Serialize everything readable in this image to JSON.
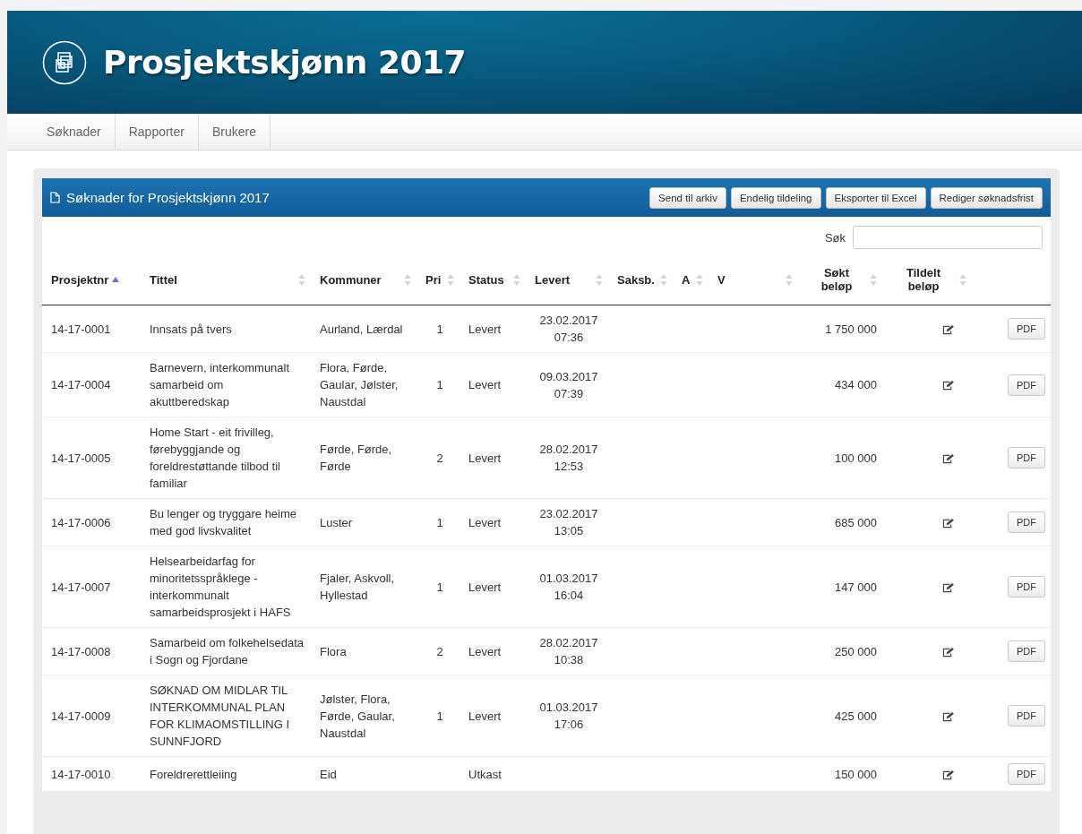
{
  "header": {
    "title": "Prosjektskjønn 2017"
  },
  "nav": [
    {
      "label": "Søknader"
    },
    {
      "label": "Rapporter"
    },
    {
      "label": "Brukere"
    }
  ],
  "panel": {
    "title": "Søknader for Prosjektskjønn 2017",
    "buttons": [
      "Send til arkiv",
      "Endelig tildeling",
      "Eksporter til Excel",
      "Rediger søknadsfrist"
    ]
  },
  "search": {
    "label": "Søk"
  },
  "table": {
    "columns": [
      {
        "label": "Prosjektnr",
        "sorted": true,
        "kind": "text"
      },
      {
        "label": "Tittel",
        "sorted": false,
        "kind": "text"
      },
      {
        "label": "Kommuner",
        "sorted": false,
        "kind": "text"
      },
      {
        "label": "Pri",
        "sorted": false,
        "kind": "text"
      },
      {
        "label": "Status",
        "sorted": false,
        "kind": "text"
      },
      {
        "label": "Levert",
        "sorted": false,
        "kind": "text"
      },
      {
        "label": "Saksb.",
        "sorted": false,
        "kind": "text"
      },
      {
        "label": "A",
        "sorted": false,
        "kind": "text"
      },
      {
        "label": "V",
        "sorted": false,
        "kind": "text"
      },
      {
        "label": "Søkt beløp",
        "sorted": false,
        "kind": "amount"
      },
      {
        "label": "Tildelt beløp",
        "sorted": false,
        "kind": "amount"
      }
    ],
    "rows": [
      {
        "id": "14-17-0001",
        "title": "Innsats på tvers",
        "municipalities": "Aurland, Lærdal",
        "pri": "1",
        "status": "Levert",
        "date": "23.02.2017",
        "time": "07:36",
        "amount": "1 750 000",
        "pdf": "PDF"
      },
      {
        "id": "14-17-0004",
        "title": "Barnevern, interkommunalt samarbeid om akuttberedskap",
        "municipalities": "Flora, Førde, Gaular, Jølster, Naustdal",
        "pri": "1",
        "status": "Levert",
        "date": "09.03.2017",
        "time": "07:39",
        "amount": "434 000",
        "pdf": "PDF"
      },
      {
        "id": "14-17-0005",
        "title": "Home Start - eit frivilleg, førebyggjande og foreldrestøttande tilbod til familiar",
        "municipalities": "Førde, Førde, Førde",
        "pri": "2",
        "status": "Levert",
        "date": "28.02.2017",
        "time": "12:53",
        "amount": "100 000",
        "pdf": "PDF"
      },
      {
        "id": "14-17-0006",
        "title": "Bu lenger og tryggare heime med god livskvalitet",
        "municipalities": "Luster",
        "pri": "1",
        "status": "Levert",
        "date": "23.02.2017",
        "time": "13:05",
        "amount": "685 000",
        "pdf": "PDF"
      },
      {
        "id": "14-17-0007",
        "title": "Helsearbeidarfag for minoritetsspråklege - interkommunalt samarbeidsprosjekt i HAFS",
        "municipalities": "Fjaler, Askvoll, Hyllestad",
        "pri": "1",
        "status": "Levert",
        "date": "01.03.2017",
        "time": "16:04",
        "amount": "147 000",
        "pdf": "PDF"
      },
      {
        "id": "14-17-0008",
        "title": "Samarbeid om folkehelsedata i Sogn og Fjordane",
        "municipalities": "Flora",
        "pri": "2",
        "status": "Levert",
        "date": "28.02.2017",
        "time": "10:38",
        "amount": "250 000",
        "pdf": "PDF"
      },
      {
        "id": "14-17-0009",
        "title": "SØKNAD OM MIDLAR TIL INTERKOMMUNAL PLAN FOR KLIMAOMSTILLING I SUNNFJORD",
        "municipalities": "Jølster, Flora, Førde, Gaular, Naustdal",
        "pri": "1",
        "status": "Levert",
        "date": "01.03.2017",
        "time": "17:06",
        "amount": "425 000",
        "pdf": "PDF"
      },
      {
        "id": "14-17-0010",
        "title": "Foreldrerettleiing",
        "municipalities": "Eid",
        "status": "Utkast",
        "amount": "150 000",
        "pdf": "PDF"
      }
    ]
  }
}
